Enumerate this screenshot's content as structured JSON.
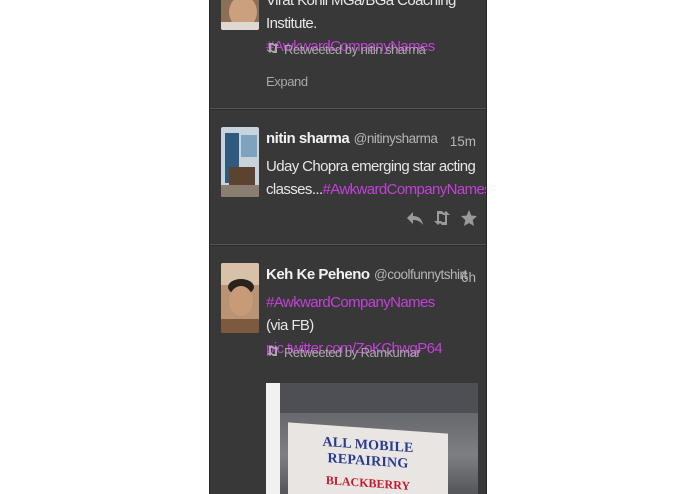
{
  "tweets": [
    {
      "text_partial": "Virat Kohli MGa/BGa Coaching Institute.",
      "hashtag": "#AwkwardCompanyNames",
      "retweeted_by": "Retweeted by nitin sharma",
      "expand_label": "Expand"
    },
    {
      "name": "nitin sharma",
      "handle": "@nitinysharma",
      "time": "15m",
      "text": "Uday Chopra emerging star acting classes...",
      "hashtag": "#AwkwardCompanyNames"
    },
    {
      "name": "Keh Ke Peheno",
      "handle": "@coolfunnytshirt",
      "time": "6h",
      "hashtag": "#AwkwardCompanyNames",
      "text_prefix": "(via FB)",
      "link": "pic.twitter.com/ZoKChwgP64",
      "retweeted_by": "Retweeted by Ramkumar",
      "photo_sign_line1": "ALL MOBILE REPAIRING",
      "photo_sign_line2": "BLACKBERRY"
    }
  ],
  "icons": {
    "retweet_small": "retweet-icon",
    "reply": "reply-icon",
    "retweet": "retweet-icon",
    "favorite": "star-icon"
  },
  "colors": {
    "background": "#383838",
    "hashtag": "#c341d8",
    "text": "#e6e6e6",
    "meta": "#a8a8a8"
  }
}
